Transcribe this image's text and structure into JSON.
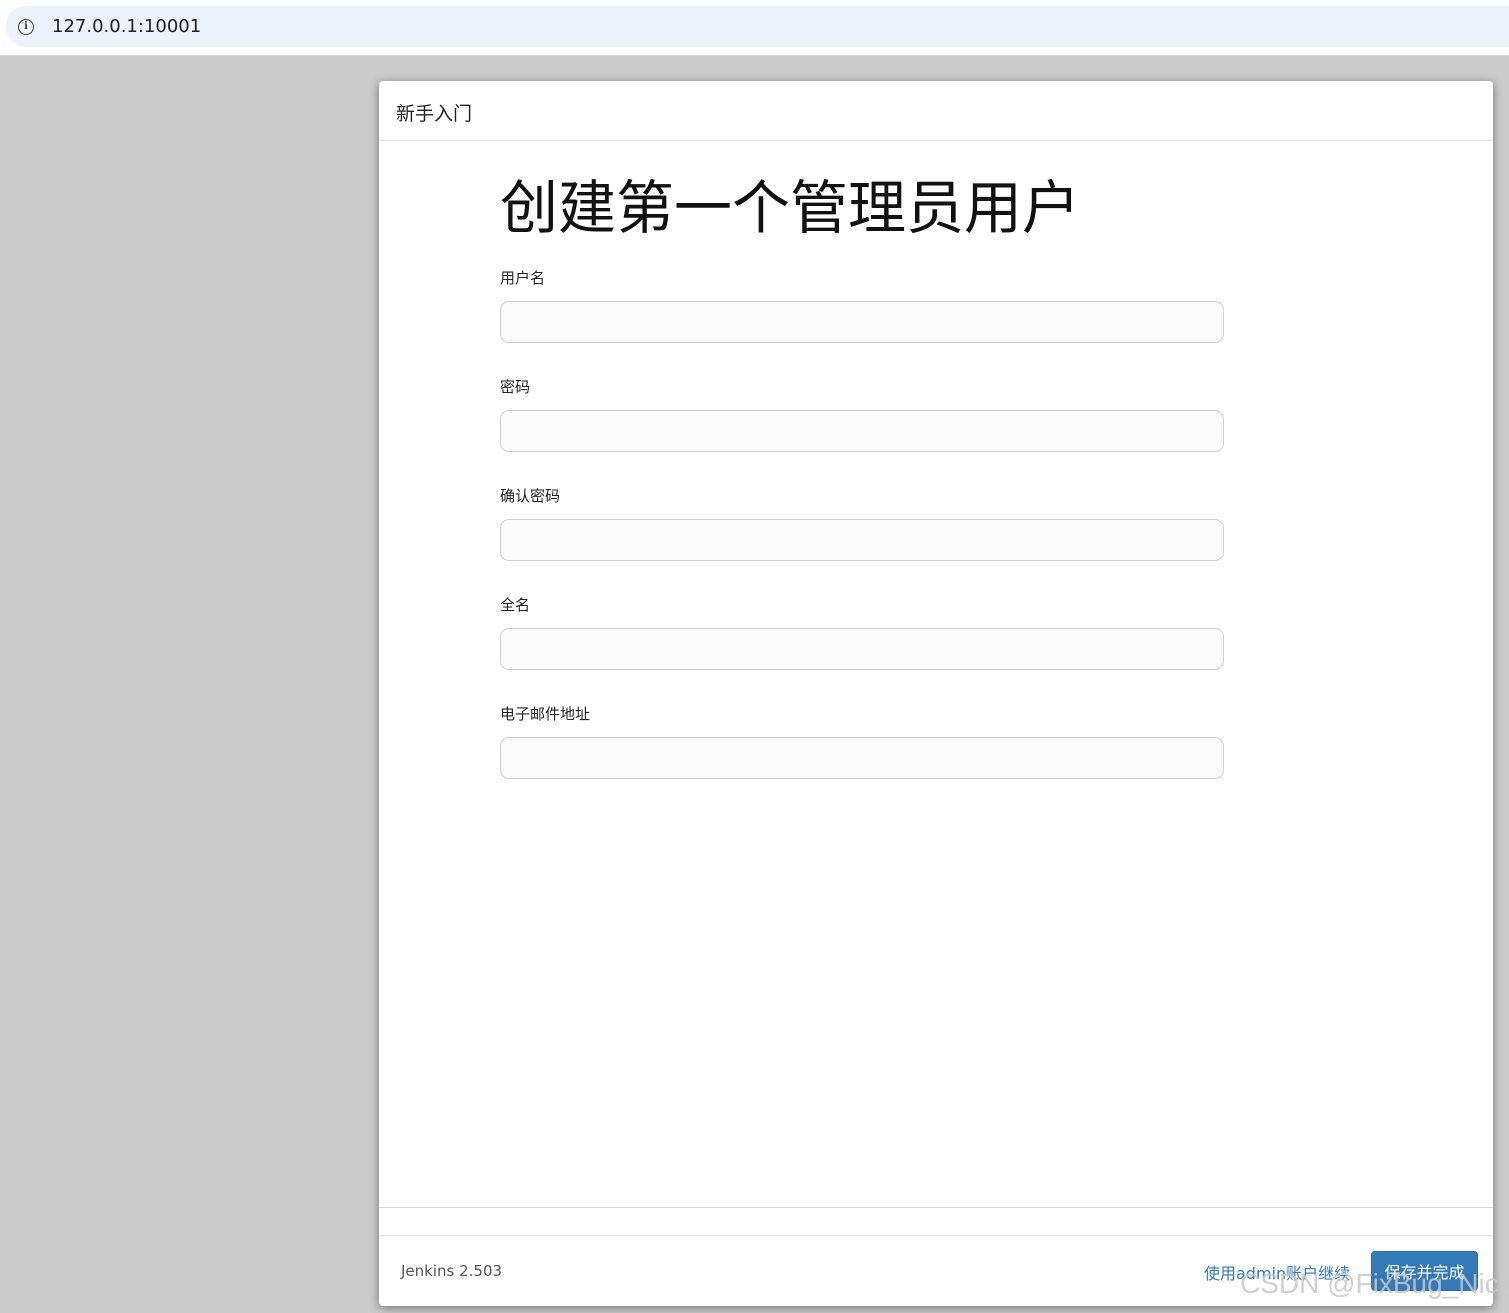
{
  "browser": {
    "url": "127.0.0.1:10001",
    "info_icon": "info-circle-icon"
  },
  "dialog": {
    "header_title": "新手入门",
    "page_title": "创建第一个管理员用户",
    "fields": [
      {
        "label": "用户名",
        "value": ""
      },
      {
        "label": "密码",
        "value": ""
      },
      {
        "label": "确认密码",
        "value": ""
      },
      {
        "label": "全名",
        "value": ""
      },
      {
        "label": "电子邮件地址",
        "value": ""
      }
    ],
    "footer": {
      "version": "Jenkins 2.503",
      "continue_link": "使用admin账户继续",
      "save_button": "保存并完成"
    }
  },
  "colors": {
    "primary": "#337ab7",
    "backdrop": "#cccccc",
    "address_bar": "#edf2fa"
  },
  "watermark": "CSDN @FixBug_Nick"
}
